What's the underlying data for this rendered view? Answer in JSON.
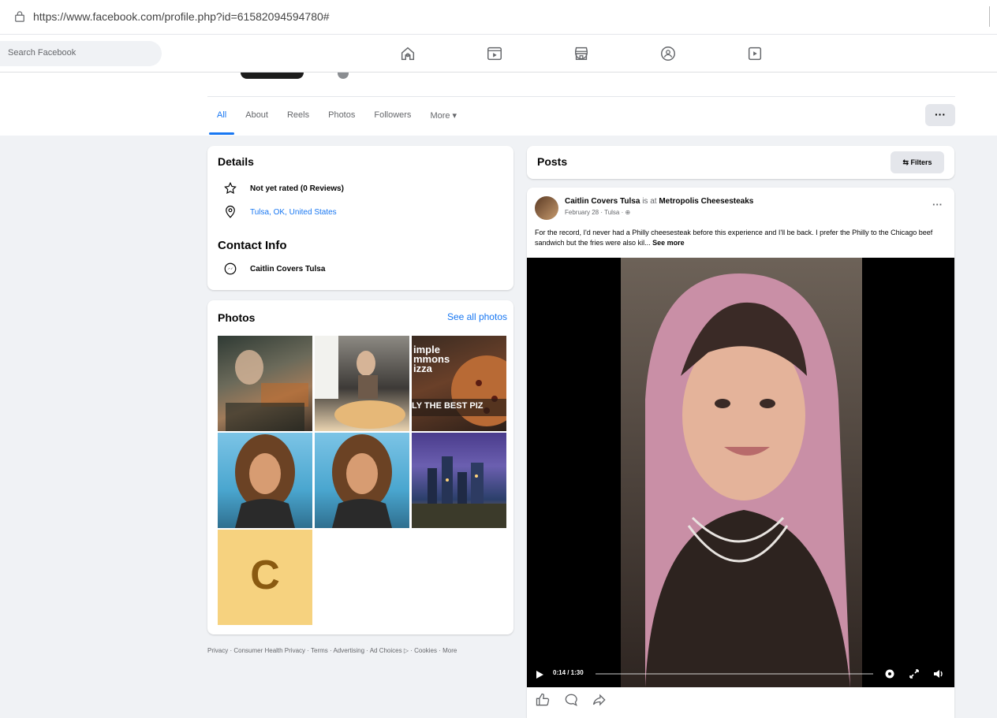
{
  "browser": {
    "url": "https://www.facebook.com/profile.php?id=61582094594780#"
  },
  "topnav": {
    "search_placeholder": "Search Facebook"
  },
  "profile_tabs": [
    {
      "label": "All"
    },
    {
      "label": "About"
    },
    {
      "label": "Reels"
    },
    {
      "label": "Photos"
    },
    {
      "label": "Followers"
    },
    {
      "label": "More ▾"
    }
  ],
  "profile_more": "···",
  "details": {
    "title": "Details",
    "rating": "Not yet rated (0 Reviews)",
    "location": "Tulsa, OK, United States",
    "contact_title": "Contact Info",
    "messenger": "Caitlin Covers Tulsa"
  },
  "photos": {
    "title": "Photos",
    "see_all": "See all photos",
    "tile3_text_a": "imple",
    "tile3_text_b": "mmons",
    "tile3_text_c": "izza",
    "tile3_banner": "LY THE BEST PIZ",
    "letter_tile": "C"
  },
  "footer": "Privacy · Consumer Health Privacy · Terms · Advertising · Ad Choices ▷ · Cookies · More",
  "posts": {
    "title": "Posts",
    "filters": "⇆ Filters"
  },
  "post": {
    "author": "Caitlin Covers Tulsa",
    "connector": "is at",
    "place": "Metropolis Cheesesteaks",
    "meta": "February 28 · Tulsa · ⊕",
    "more": "···",
    "text": "For the record, I'd never had a Philly cheesesteak before this experience and I'll be back. I prefer the Philly to the Chicago beef sandwich but the fries were also kil...",
    "see_more": "See more",
    "video_time": "0:14 / 1:30",
    "video_progress": 0.0
  },
  "colors": {
    "accent": "#1877f2",
    "page_bg": "#f0f2f5"
  }
}
